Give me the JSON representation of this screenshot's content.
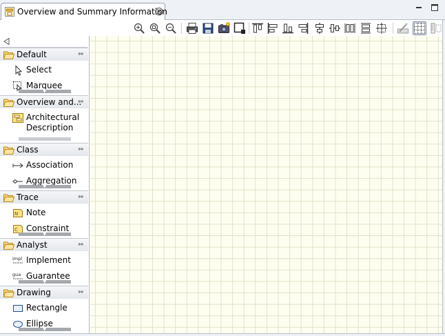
{
  "editor_tab": {
    "title": "Overview and Summary Information",
    "close_glyph": "⨂",
    "icon": "diagram-icon"
  },
  "window_controls": {
    "minimize_icon": "minimize-icon",
    "maximize_icon": "maximize-icon"
  },
  "toolbar": {
    "icons": [
      "zoom-in-icon",
      "zoom-to-fit-icon",
      "zoom-out-icon",
      "print-icon",
      "save-icon",
      "export-image-icon",
      "select-all-icon",
      "align-top-icon",
      "align-left-icon",
      "align-bottom-icon",
      "align-right-icon",
      "align-center-icon",
      "align-middle-icon",
      "match-width-icon",
      "match-height-icon",
      "match-size-icon",
      "snap-to-geometry-icon",
      "grid-icon",
      "ruler-icon"
    ]
  },
  "palette": {
    "drawers": [
      {
        "name": "Default",
        "tools": [
          {
            "label": "Select",
            "icon": "arrow-cursor-icon"
          },
          {
            "label": "Marquee",
            "icon": "marquee-icon"
          }
        ]
      },
      {
        "name": "Overview and...",
        "tools": [
          {
            "label": "Architectural Description",
            "icon": "architectural-description-icon"
          }
        ]
      },
      {
        "name": "Class",
        "tools": [
          {
            "label": "Association",
            "icon": "association-icon"
          },
          {
            "label": "Aggregation",
            "icon": "aggregation-icon"
          }
        ]
      },
      {
        "name": "Trace",
        "tools": [
          {
            "label": "Note",
            "icon": "note-icon"
          },
          {
            "label": "Constraint",
            "icon": "constraint-icon"
          }
        ]
      },
      {
        "name": "Analyst",
        "tools": [
          {
            "label": "Implement",
            "icon": "implement-icon"
          },
          {
            "label": "Guarantee",
            "icon": "guarantee-icon"
          }
        ]
      },
      {
        "name": "Drawing",
        "tools": [
          {
            "label": "Rectangle",
            "icon": "rectangle-icon"
          },
          {
            "label": "Ellipse",
            "icon": "ellipse-icon"
          }
        ]
      }
    ]
  },
  "colors": {
    "canvas_background": "#fefef0",
    "grid_line": "#dfe2c8",
    "folder": "#e8b84a"
  }
}
